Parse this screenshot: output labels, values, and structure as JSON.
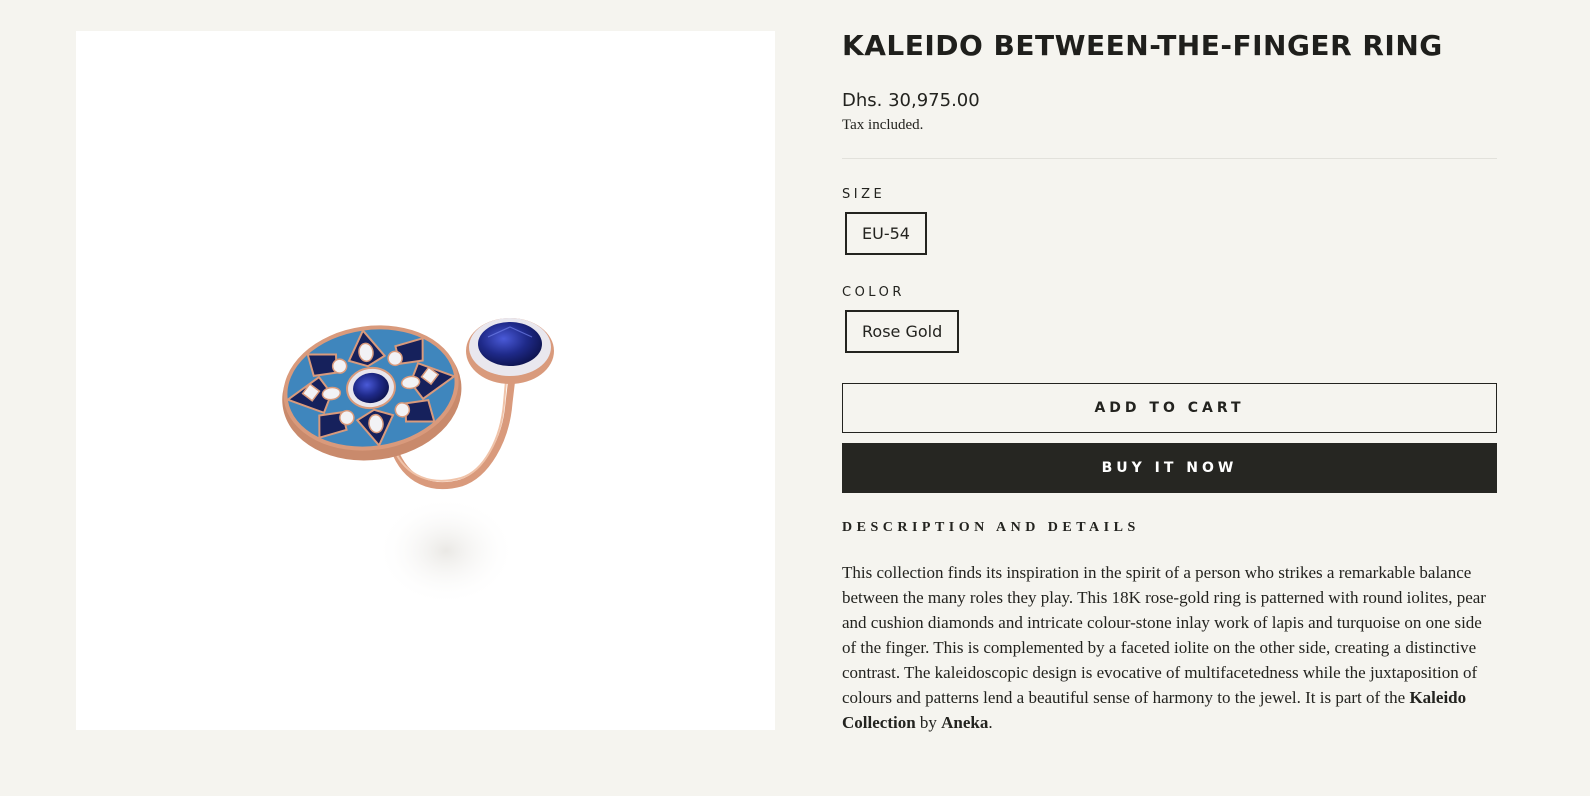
{
  "product": {
    "image_alt": "Kaleido Between-the-Finger Ring",
    "title": "KALEIDO BETWEEN-THE-FINGER RING",
    "price": "Dhs. 30,975.00",
    "tax_note": "Tax included."
  },
  "options": {
    "size": {
      "label": "SIZE",
      "value": "EU-54"
    },
    "color": {
      "label": "COLOR",
      "value": "Rose Gold"
    }
  },
  "buttons": {
    "add_to_cart": "ADD TO CART",
    "buy_now": "BUY IT NOW"
  },
  "description": {
    "heading": "DESCRIPTION AND DETAILS",
    "body_text": "This collection finds its inspiration in the spirit of a person who strikes a remarkable balance between the many roles they play. This 18K rose-gold ring is patterned with round iolites, pear and cushion diamonds and intricate colour-stone inlay work of lapis and turquoise on one side of the finger. This is complemented by a faceted iolite on the other side, creating a distinctive contrast. The kaleidoscopic design is evocative of multifacetedness while the juxtaposition of colours and patterns lend a beautiful sense of harmony to the jewel. It is part of the",
    "collection_link": "Kaleido Collection",
    "by_text": "by",
    "brand_link": "Aneka",
    "end_punct": "."
  },
  "colors": {
    "background": "#f5f4ef",
    "text": "#23231f",
    "button_dark": "#262622",
    "rose_gold": "#d99a7c",
    "iolite": "#1f2a8a",
    "lapis": "#16215c",
    "turquoise": "#3f86bd"
  }
}
